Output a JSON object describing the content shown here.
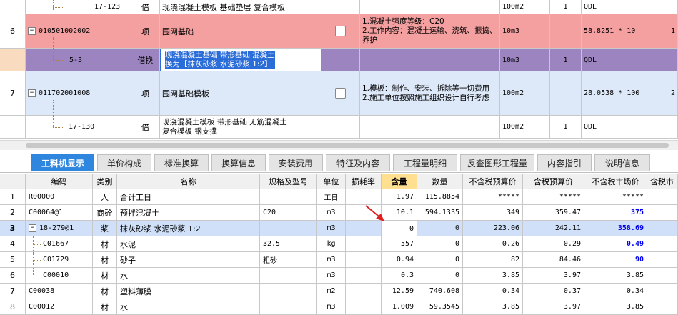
{
  "top_rows": [
    {
      "num": "",
      "code": "17-123",
      "type": "借",
      "name": "现浇混凝土模板 基础垫层 复合模板",
      "features": "",
      "unit": "100m2",
      "qty": "1",
      "expr": "QDL",
      "extra": ""
    },
    {
      "num": "6",
      "code": "010501002002",
      "type": "项",
      "name": "围网基础",
      "features": "1.混凝土强度等级：C20\n2.工作内容：混凝土运输、浇筑、振捣、养护",
      "unit": "10m3",
      "qty": "",
      "expr": "58.8251 * 10",
      "extra": "1"
    },
    {
      "num": "",
      "code": "5-3",
      "type": "借换",
      "name": "现浇混凝土基础 带形基础 混凝土\n换为【抹灰砂浆 水泥砂浆 1:2】",
      "features": "",
      "unit": "10m3",
      "qty": "1",
      "expr": "QDL",
      "extra": ""
    },
    {
      "num": "7",
      "code": "011702001008",
      "type": "项",
      "name": "围网基础模板",
      "features": "1.模板：制作、安装、拆除等一切费用\n2.施工单位按照施工组织设计自行考虑",
      "unit": "100m2",
      "qty": "",
      "expr": "28.0538 * 100",
      "extra": "2"
    },
    {
      "num": "",
      "code": "17-130",
      "type": "借",
      "name": "现浇混凝土模板 带形基础 无筋混凝土\n复合模板 钢支撑",
      "features": "",
      "unit": "100m2",
      "qty": "1",
      "expr": "QDL",
      "extra": ""
    }
  ],
  "tabs": [
    "工料机显示",
    "单价构成",
    "标准换算",
    "换算信息",
    "安装费用",
    "特征及内容",
    "工程量明细",
    "反查图形工程量",
    "内容指引",
    "说明信息"
  ],
  "grid": {
    "headers": [
      "",
      "编码",
      "类别",
      "名称",
      "规格及型号",
      "单位",
      "损耗率",
      "含量",
      "数量",
      "不含税预算价",
      "含税预算价",
      "不含税市场价",
      "含税市"
    ],
    "rows": [
      {
        "n": "1",
        "code": "R00000",
        "cat": "人",
        "name": "合计工日",
        "spec": "",
        "unit": "工日",
        "loss": "",
        "content": "1.97",
        "qty": "115.8854",
        "p1": "*****",
        "p2": "*****",
        "p3": "*****",
        "p4": "",
        "p3blue": false
      },
      {
        "n": "2",
        "code": "C00064@1",
        "cat": "商砼",
        "name": "预拌混凝土",
        "spec": "C20",
        "unit": "m3",
        "loss": "",
        "content": "10.1",
        "qty": "594.1335",
        "p1": "349",
        "p2": "359.47",
        "p3": "375",
        "p4": "",
        "p3blue": true
      },
      {
        "n": "3",
        "code": "18-279@1",
        "cat": "浆",
        "name": "抹灰砂浆 水泥砂浆 1:2",
        "spec": "",
        "unit": "m3",
        "loss": "",
        "content": "0",
        "qty": "0",
        "p1": "223.06",
        "p2": "242.11",
        "p3": "358.69",
        "p4": "",
        "p3blue": true
      },
      {
        "n": "4",
        "code": "C01667",
        "cat": "材",
        "name": "水泥",
        "spec": "32.5",
        "unit": "kg",
        "loss": "",
        "content": "557",
        "qty": "0",
        "p1": "0.26",
        "p2": "0.29",
        "p3": "0.49",
        "p4": "",
        "p3blue": true
      },
      {
        "n": "5",
        "code": "C01729",
        "cat": "材",
        "name": "砂子",
        "spec": "粗砂",
        "unit": "m3",
        "loss": "",
        "content": "0.94",
        "qty": "0",
        "p1": "82",
        "p2": "84.46",
        "p3": "90",
        "p4": "",
        "p3blue": true
      },
      {
        "n": "6",
        "code": "C00010",
        "cat": "材",
        "name": "水",
        "spec": "",
        "unit": "m3",
        "loss": "",
        "content": "0.3",
        "qty": "0",
        "p1": "3.85",
        "p2": "3.97",
        "p3": "3.85",
        "p4": "",
        "p3blue": false
      },
      {
        "n": "7",
        "code": "C00038",
        "cat": "材",
        "name": "塑料薄膜",
        "spec": "",
        "unit": "m2",
        "loss": "",
        "content": "12.59",
        "qty": "740.608",
        "p1": "0.34",
        "p2": "0.37",
        "p3": "0.34",
        "p4": "",
        "p3blue": false
      },
      {
        "n": "8",
        "code": "C00012",
        "cat": "材",
        "name": "水",
        "spec": "",
        "unit": "m3",
        "loss": "",
        "content": "1.009",
        "qty": "59.3545",
        "p1": "3.85",
        "p2": "3.97",
        "p3": "3.85",
        "p4": "",
        "p3blue": false
      }
    ]
  },
  "colors": {
    "pink": "#f4a0a0",
    "purple": "#9b84c0",
    "lightblue": "#dde8f8",
    "selected": "#cfe0f8",
    "tab_active": "#2e86de"
  }
}
